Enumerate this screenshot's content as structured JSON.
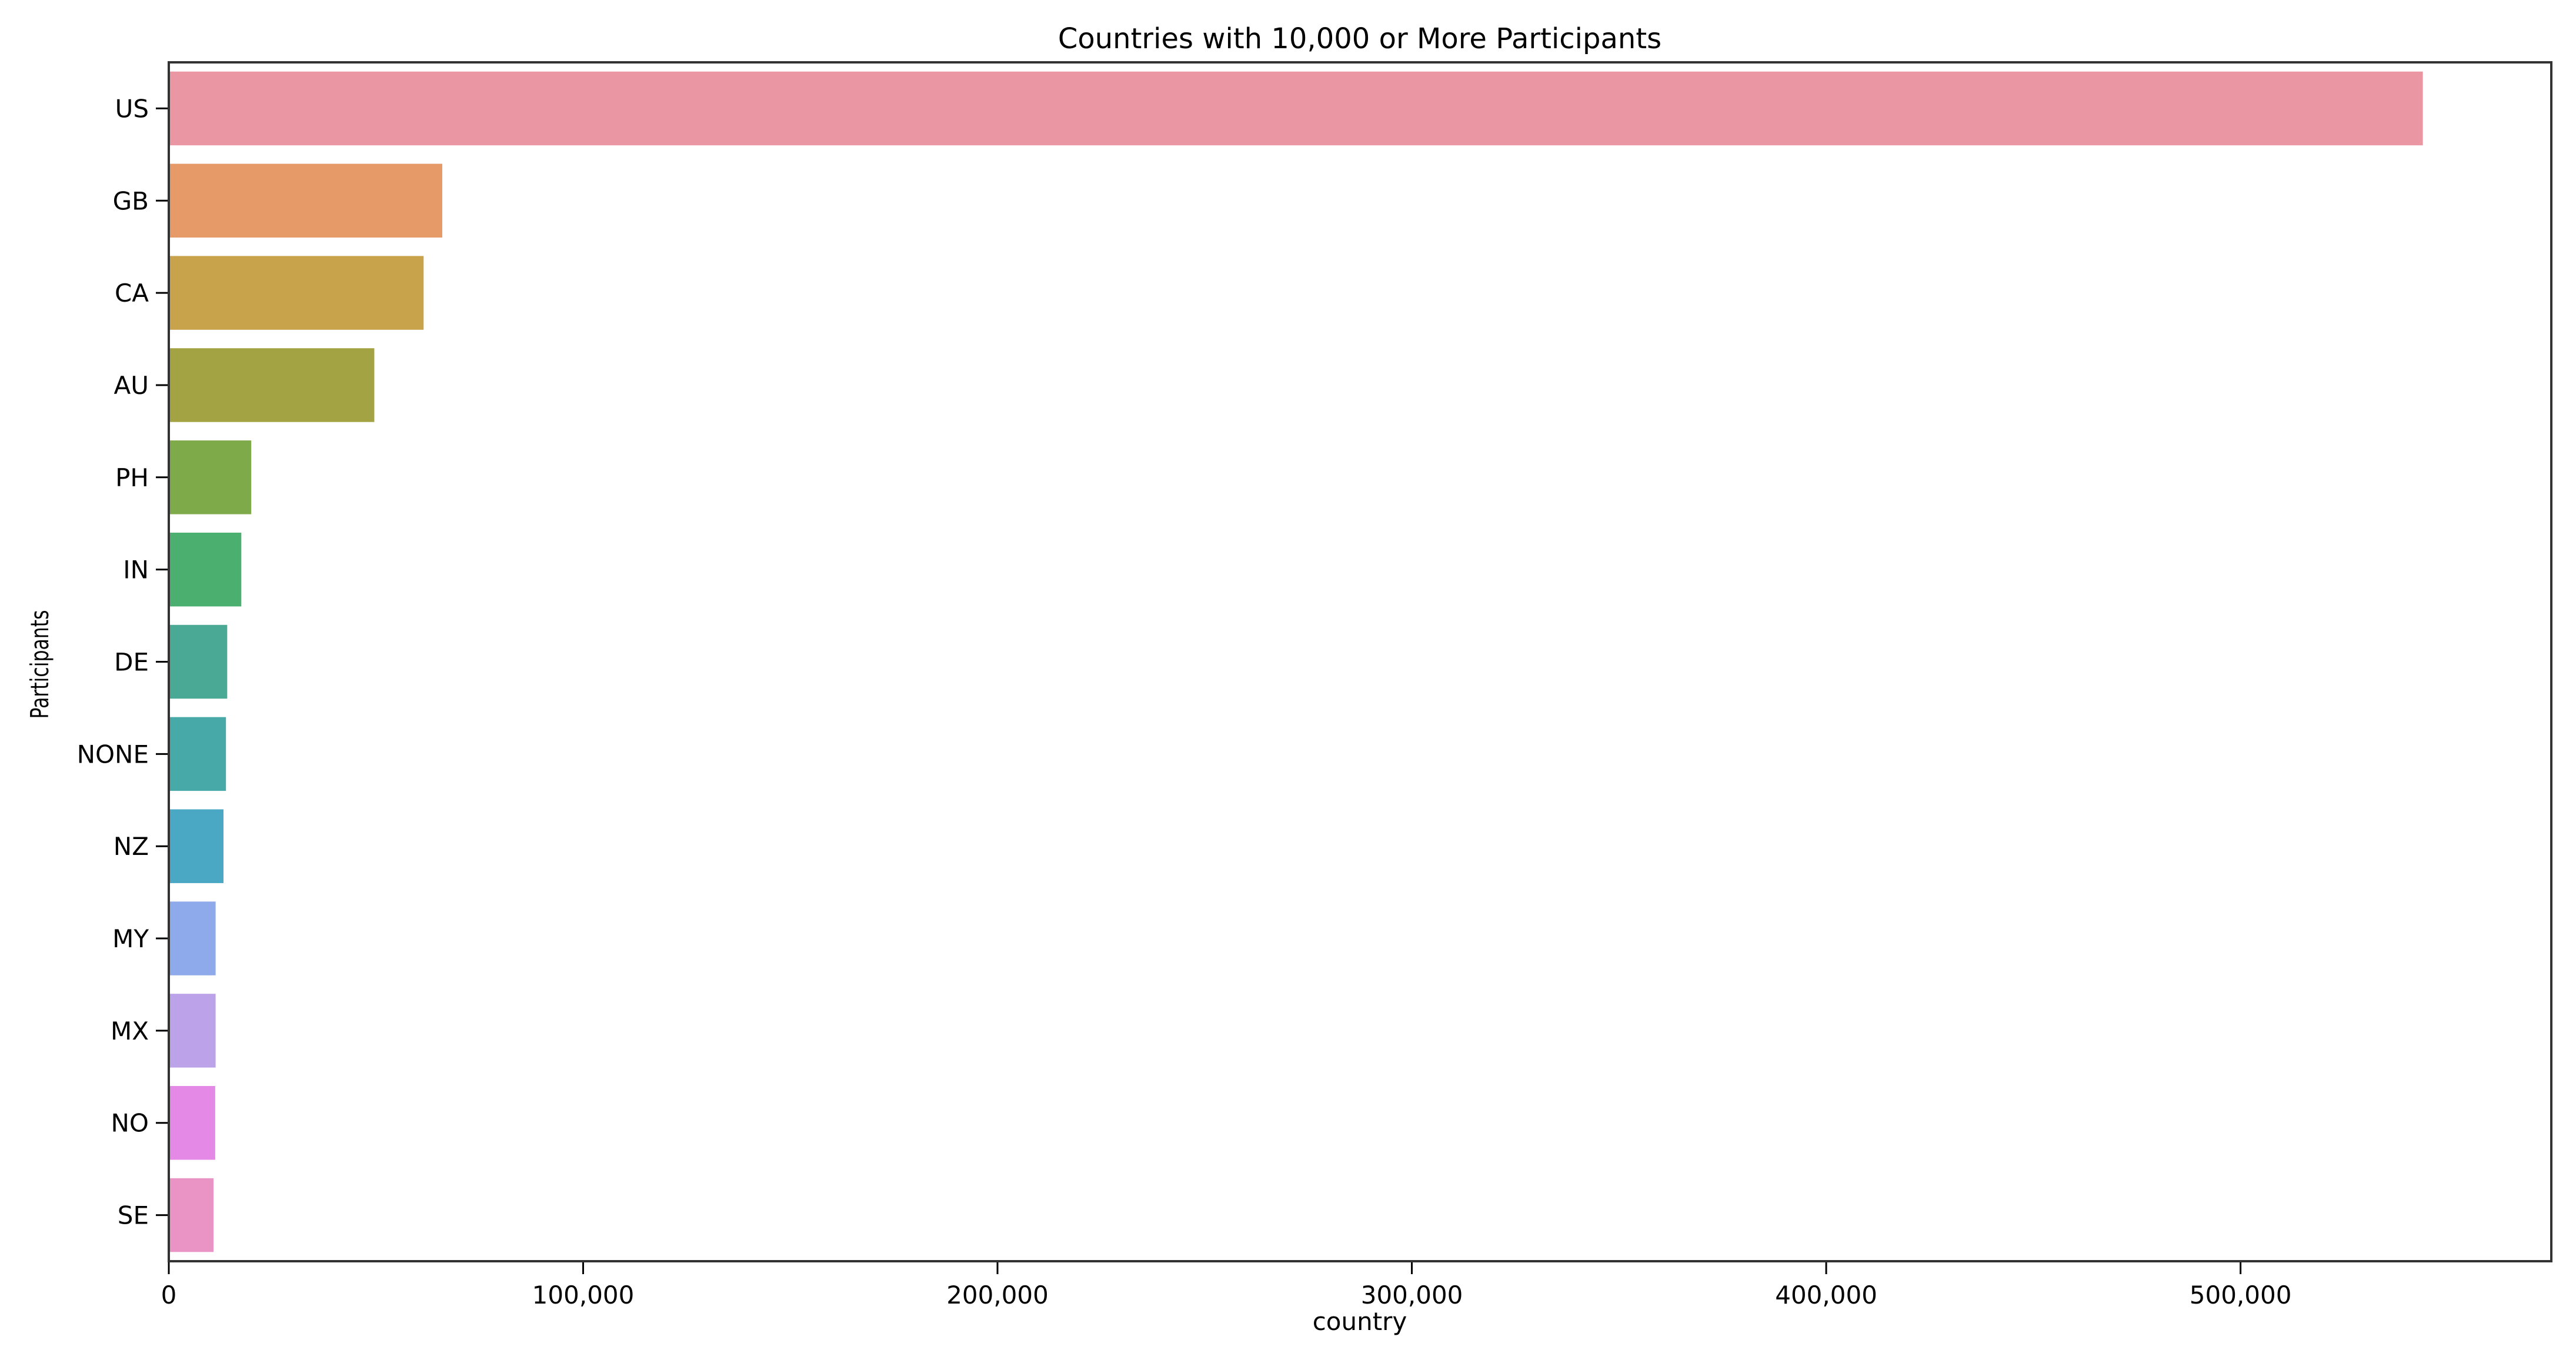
{
  "chart_data": {
    "type": "bar",
    "orientation": "horizontal",
    "title": "Countries with 10,000 or More Participants",
    "xlabel": "country",
    "ylabel": "Participants",
    "categories": [
      "US",
      "GB",
      "CA",
      "AU",
      "PH",
      "IN",
      "DE",
      "NONE",
      "NZ",
      "MY",
      "MX",
      "NO",
      "SE"
    ],
    "values": [
      544000,
      66000,
      61500,
      49600,
      19900,
      17500,
      14100,
      13800,
      13200,
      11300,
      11300,
      11200,
      10800
    ],
    "colors": [
      "#ea96a3",
      "#e59a68",
      "#c9a24c",
      "#a3a343",
      "#7faa4a",
      "#4aaf6f",
      "#4aa994",
      "#48aaa8",
      "#4ba8c4",
      "#8eaaea",
      "#bca2e8",
      "#e589e6",
      "#ea94c6"
    ],
    "xticks": [
      0,
      100000,
      200000,
      300000,
      400000,
      500000
    ],
    "xtick_labels": [
      "0",
      "100,000",
      "200,000",
      "300,000",
      "400,000",
      "500,000"
    ],
    "xlim": [
      0,
      575000
    ],
    "grid": false
  }
}
